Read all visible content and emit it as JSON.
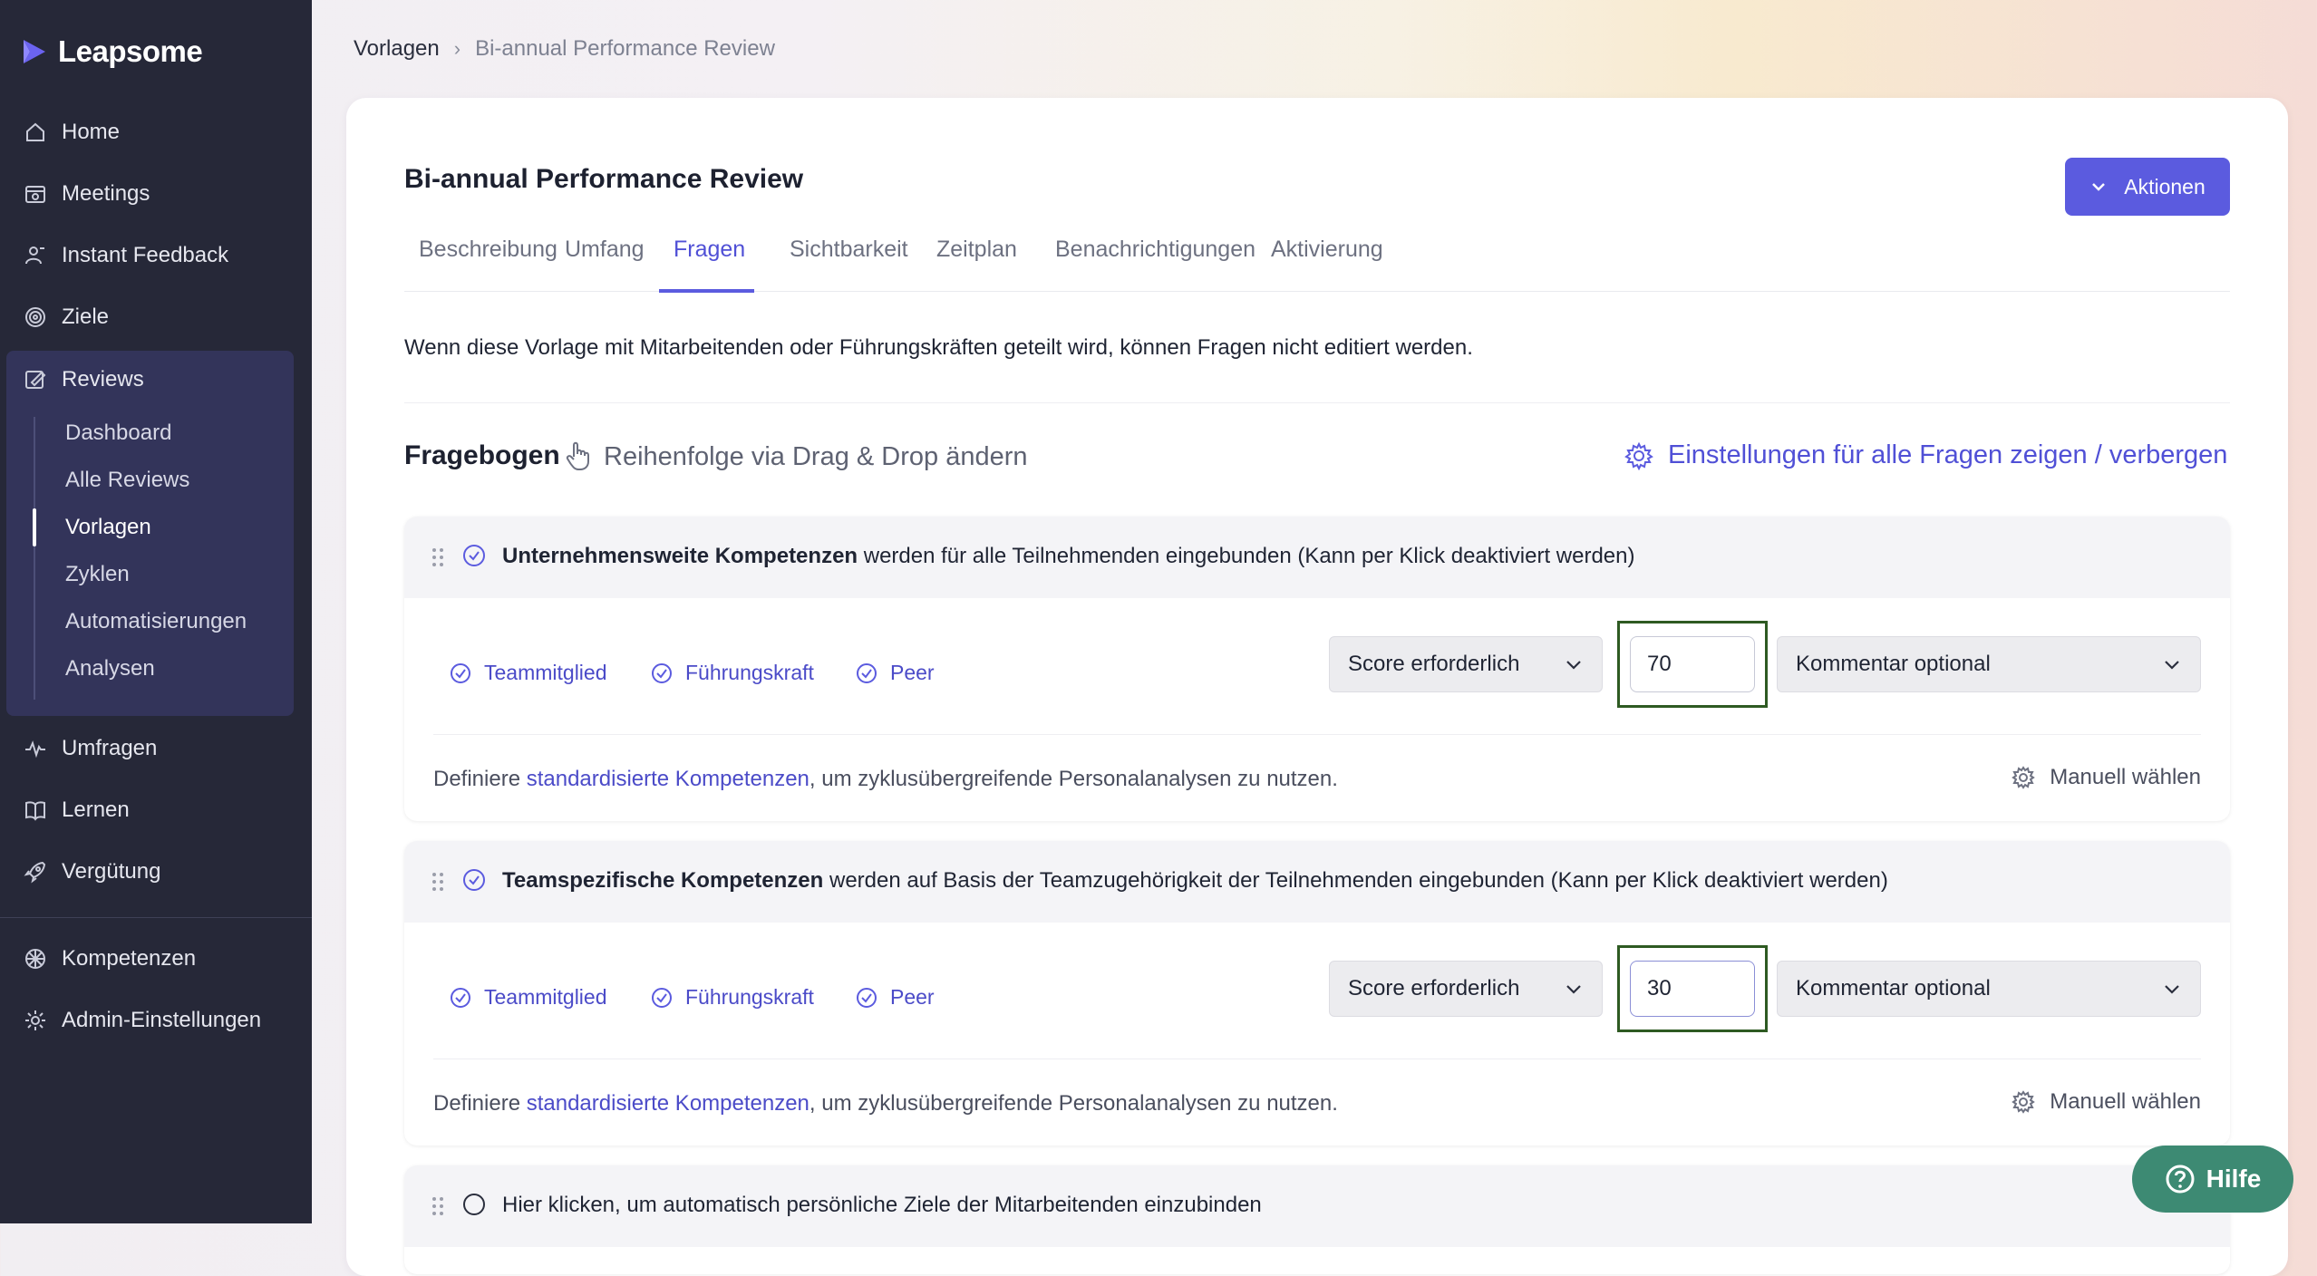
{
  "brand": {
    "name": "Leapsome"
  },
  "sidebar": {
    "items": [
      {
        "label": "Home",
        "icon": "home-icon"
      },
      {
        "label": "Meetings",
        "icon": "meetings-icon"
      },
      {
        "label": "Instant Feedback",
        "icon": "feedback-icon"
      },
      {
        "label": "Ziele",
        "icon": "target-icon"
      },
      {
        "label": "Reviews",
        "icon": "reviews-icon"
      },
      {
        "label": "Umfragen",
        "icon": "pulse-icon"
      },
      {
        "label": "Lernen",
        "icon": "book-icon"
      },
      {
        "label": "Vergütung",
        "icon": "rocket-icon"
      },
      {
        "label": "Kompetenzen",
        "icon": "competencies-icon"
      },
      {
        "label": "Admin-Einstellungen",
        "icon": "gear-icon"
      }
    ],
    "reviews_sub": [
      "Dashboard",
      "Alle Reviews",
      "Vorlagen",
      "Zyklen",
      "Automatisierungen",
      "Analysen"
    ],
    "active_sub": "Vorlagen"
  },
  "breadcrumb": {
    "root": "Vorlagen",
    "separator": "›",
    "current": "Bi-annual Performance Review"
  },
  "page": {
    "title": "Bi-annual Performance Review",
    "actions_label": "Aktionen",
    "tabs": [
      "Beschreibung",
      "Umfang",
      "Fragen",
      "Sichtbarkeit",
      "Zeitplan",
      "Benachrichtigungen",
      "Aktivierung"
    ],
    "active_tab": "Fragen",
    "notice": "Wenn diese Vorlage mit Mitarbeitenden oder Führungskräften geteilt wird, können Fragen nicht editiert werden."
  },
  "fragebogen": {
    "title": "Fragebogen",
    "hint": "Reihenfolge via Drag & Drop ändern",
    "settings_link": "Einstellungen für alle Fragen zeigen / verbergen"
  },
  "blocks": [
    {
      "title_bold": "Unternehmensweite Kompetenzen",
      "title_rest": " werden für alle Teilnehmenden eingebunden (Kann per Klick deaktiviert werden)",
      "roles": [
        "Teammitglied",
        "Führungskraft",
        "Peer"
      ],
      "score_select": "Score erforderlich",
      "weight": "70",
      "comment_select": "Kommentar optional",
      "define_prefix": "Definiere ",
      "define_link": "standardisierte Kompetenzen",
      "define_suffix": ", um zyklusübergreifende Personalanalysen zu nutzen.",
      "manual_label": "Manuell wählen"
    },
    {
      "title_bold": "Teamspezifische Kompetenzen",
      "title_rest": " werden auf Basis der Teamzugehörigkeit der Teilnehmenden eingebunden (Kann per Klick deaktiviert werden)",
      "roles": [
        "Teammitglied",
        "Führungskraft",
        "Peer"
      ],
      "score_select": "Score erforderlich",
      "weight": "30",
      "comment_select": "Kommentar optional",
      "define_prefix": "Definiere ",
      "define_link": "standardisierte Kompetenzen",
      "define_suffix": ", um zyklusübergreifende Personalanalysen zu nutzen.",
      "manual_label": "Manuell wählen"
    },
    {
      "title_rest": "Hier klicken, um automatisch persönliche Ziele der Mitarbeitenden einzubinden"
    }
  ],
  "help": {
    "label": "Hilfe"
  },
  "colors": {
    "sidebar_bg": "#262838",
    "accent": "#5b5bdf",
    "help_bg": "#3d8a73",
    "highlight_frame": "#2e5a22"
  }
}
